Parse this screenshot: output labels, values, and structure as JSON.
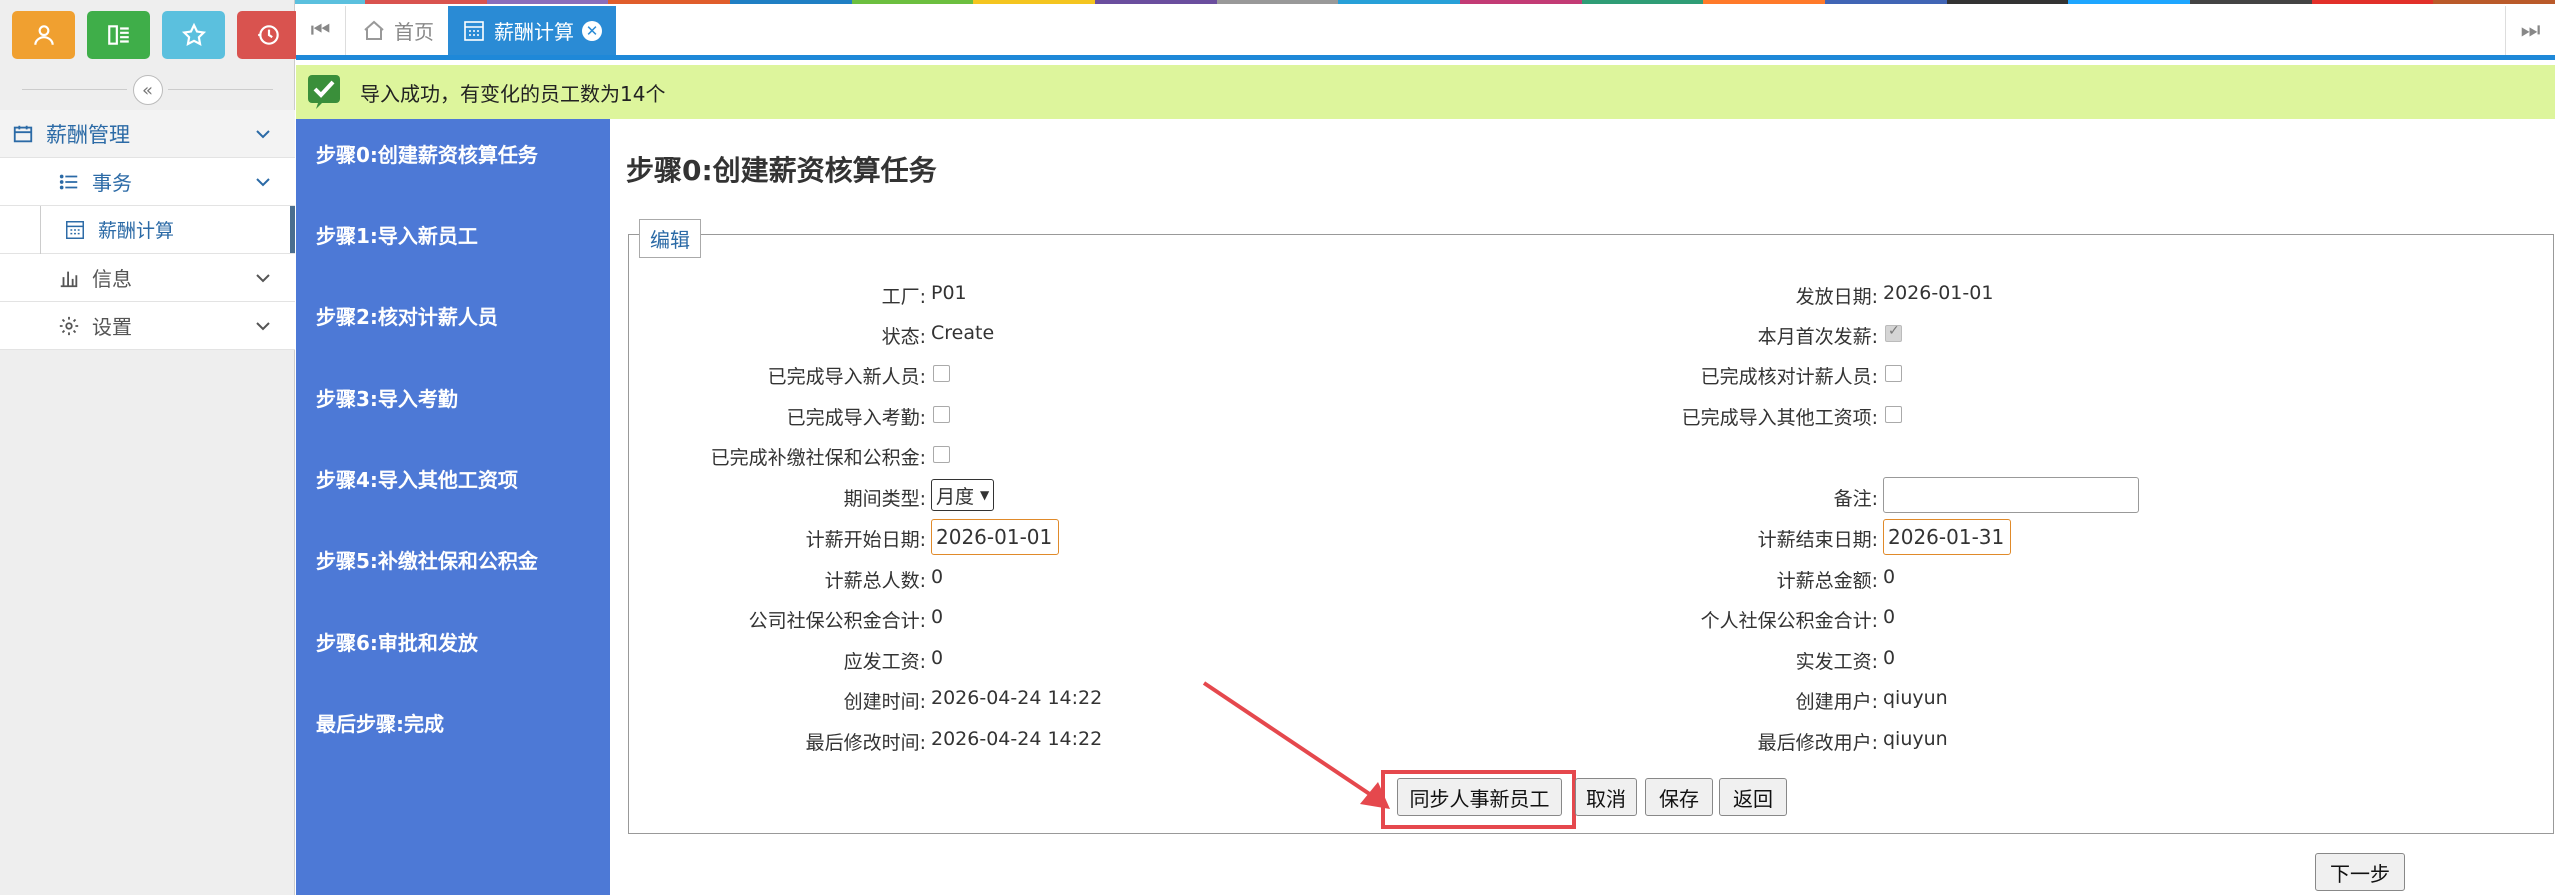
{
  "colors": {
    "strip": [
      "#f2a43a",
      "#3bb54a",
      "#5bc0de",
      "#d9534f",
      "#8a6dbb",
      "#e05d2b",
      "#1f7fc4",
      "#6cbf3f",
      "#f4c51f",
      "#6b4e9e",
      "#999999",
      "#27a0d8",
      "#c33b75",
      "#2f9d76",
      "#ff7a2a",
      "#4165b5",
      "#333333",
      "#1ea6ff",
      "#444444",
      "#e2302a",
      "#ba5a2a"
    ],
    "quick_user": "#f0a030",
    "quick_list": "#3fae49",
    "quick_star": "#5bc0de",
    "quick_history": "#d9534f",
    "accent": "#2a8bd5",
    "steps_bg": "#4d79d6",
    "success_bg": "#ddf59c",
    "highlight": "#e5484d"
  },
  "sidebar": {
    "quick_buttons": [
      {
        "icon": "user-icon"
      },
      {
        "icon": "list-icon"
      },
      {
        "icon": "star-icon"
      },
      {
        "icon": "history-icon"
      }
    ],
    "menu": {
      "group_label": "薪酬管理",
      "affairs_label": "事务",
      "payroll_label": "薪酬计算",
      "info_label": "信息",
      "settings_label": "设置"
    }
  },
  "tabs": {
    "home_label": "首页",
    "active_label": "薪酬计算"
  },
  "notice": {
    "message": "导入成功，有变化的员工数为14个"
  },
  "steps": [
    "步骤0:创建薪资核算任务",
    "步骤1:导入新员工",
    "步骤2:核对计薪人员",
    "步骤3:导入考勤",
    "步骤4:导入其他工资项",
    "步骤5:补缴社保和公积金",
    "步骤6:审批和发放",
    "最后步骤:完成"
  ],
  "form": {
    "title": "步骤0:创建薪资核算任务",
    "legend": "编辑",
    "factory_label": "工厂:",
    "factory_value": "P01",
    "pay_date_label": "发放日期:",
    "pay_date_value": "2026-01-01",
    "status_label": "状态:",
    "status_value": "Create",
    "first_pay_label": "本月首次发薪:",
    "first_pay_checked": true,
    "new_emp_label": "已完成导入新人员:",
    "check_emp_label": "已完成核对计薪人员:",
    "attendance_label": "已完成导入考勤:",
    "other_items_label": "已完成导入其他工资项:",
    "social_label": "已完成补缴社保和公积金:",
    "period_type_label": "期间类型:",
    "period_type_value": "月度",
    "remark_label": "备注:",
    "remark_value": "",
    "start_date_label": "计薪开始日期:",
    "start_date_value": "2026-01-01",
    "end_date_label": "计薪结束日期:",
    "end_date_value": "2026-01-31",
    "total_people_label": "计薪总人数:",
    "total_people_value": "0",
    "total_amount_label": "计薪总金额:",
    "total_amount_value": "0",
    "company_social_label": "公司社保公积金合计:",
    "company_social_value": "0",
    "personal_social_label": "个人社保公积金合计:",
    "personal_social_value": "0",
    "gross_label": "应发工资:",
    "gross_value": "0",
    "net_label": "实发工资:",
    "net_value": "0",
    "created_time_label": "创建时间:",
    "created_time_value": "2026-04-24 14:22",
    "created_user_label": "创建用户:",
    "created_user_value": "qiuyun",
    "modified_time_label": "最后修改时间:",
    "modified_time_value": "2026-04-24 14:22",
    "modified_user_label": "最后修改用户:",
    "modified_user_value": "qiuyun"
  },
  "buttons": {
    "sync": "同步人事新员工",
    "cancel": "取消",
    "save": "保存",
    "back": "返回",
    "next": "下一步"
  }
}
